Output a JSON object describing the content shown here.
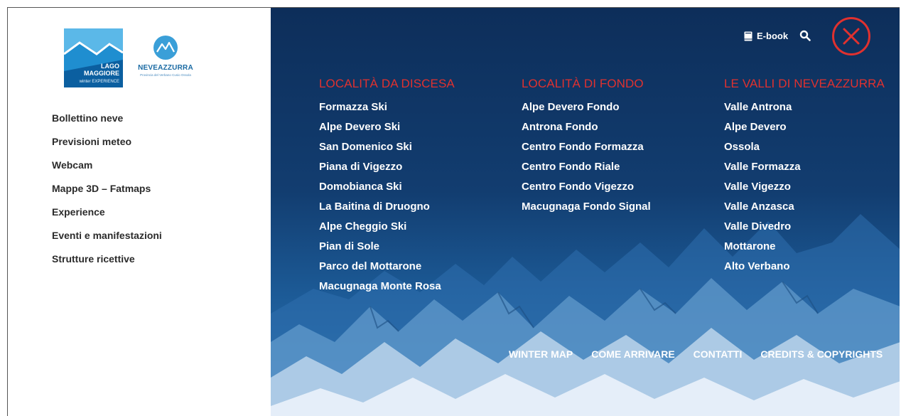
{
  "branding": {
    "lago_lines": [
      "LAGO",
      "MAGGIORE",
      "winter EXPERIENCE"
    ],
    "neve_title": "NEVEAZZURRA",
    "neve_subtitle": "Provincia del Verbano Cusio Ossola"
  },
  "sidebar": {
    "items": [
      {
        "label": "Bollettino neve"
      },
      {
        "label": "Previsioni meteo"
      },
      {
        "label": "Webcam"
      },
      {
        "label": "Mappe 3D – Fatmaps"
      },
      {
        "label": "Experience"
      },
      {
        "label": "Eventi e manifestazioni"
      },
      {
        "label": "Strutture ricettive"
      }
    ]
  },
  "header": {
    "ebook_label": "E-book",
    "icons": [
      "book-icon",
      "search-icon",
      "close-icon"
    ]
  },
  "columns": [
    {
      "title": "LOCALITÀ DA DISCESA",
      "items": [
        "Formazza Ski",
        "Alpe Devero Ski",
        "San Domenico Ski",
        "Piana di Vigezzo",
        "Domobianca Ski",
        "La Baitina di Druogno",
        "Alpe Cheggio Ski",
        "Pian di Sole",
        "Parco del Mottarone",
        "Macugnaga Monte Rosa"
      ]
    },
    {
      "title": "LOCALITÀ DI FONDO",
      "items": [
        "Alpe Devero Fondo",
        "Antrona Fondo",
        "Centro Fondo Formazza",
        "Centro Fondo Riale",
        "Centro Fondo Vigezzo",
        "Macugnaga Fondo Signal"
      ]
    },
    {
      "title": "LE VALLI DI NEVEAZZURRA",
      "items": [
        "Valle Antrona",
        "Alpe Devero",
        "Ossola",
        "Valle Formazza",
        "Valle Vigezzo",
        "Valle Anzasca",
        "Valle Divedro",
        "Mottarone",
        "Alto Verbano"
      ]
    }
  ],
  "footer": {
    "links": [
      "WINTER MAP",
      "COME ARRIVARE",
      "CONTATTI",
      "CREDITS & COPYRIGHTS"
    ]
  },
  "colors": {
    "accent_red": "#e0312f",
    "panel_dark": "#0d2e5a",
    "brand_blue": "#1a6aa3"
  }
}
